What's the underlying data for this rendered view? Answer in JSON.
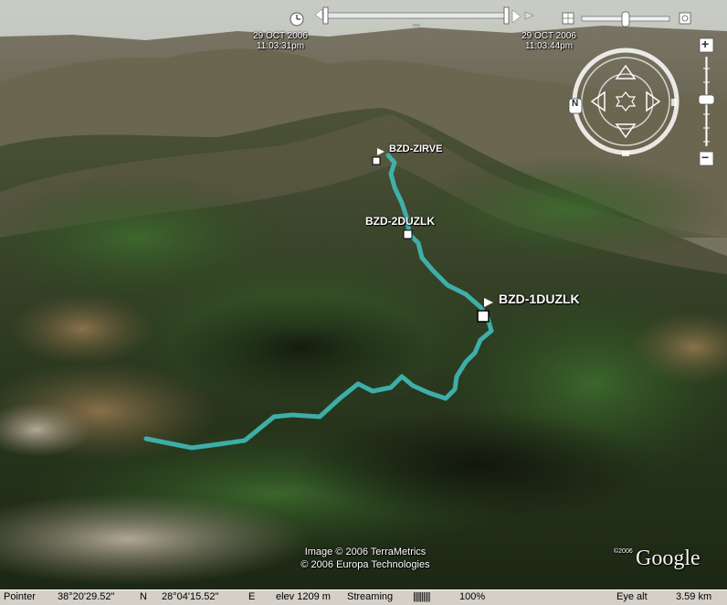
{
  "time_slider": {
    "start_date": "29 OCT 2006",
    "start_time": "11:03:31pm",
    "end_date": "29 OCT 2006",
    "end_time": "11:03:44pm"
  },
  "placemarks": [
    {
      "label": "BZD-ZIRVE"
    },
    {
      "label": "BZD-2DUZLK"
    },
    {
      "label": "BZD-1DUZLK"
    }
  ],
  "nav": {
    "north_label": "N",
    "zoom_in": "+",
    "zoom_out": "−"
  },
  "attribution": {
    "line1": "Image © 2006 TerraMetrics",
    "line2": "© 2006 Europa Technologies",
    "logo_year": "©2006",
    "logo": "Google"
  },
  "status": {
    "pointer_label": "Pointer",
    "latitude": "38°20'29.52\"",
    "lat_hemi": "N",
    "longitude": "28°04'15.52\"",
    "lon_hemi": "E",
    "elevation": "elev 1209 m",
    "streaming_label": "Streaming",
    "streaming_bar": "||||||||||",
    "streaming_pct": "100%",
    "eye_label": "Eye alt",
    "eye_alt": "3.59 km"
  },
  "colors": {
    "track": "#3fb8b4",
    "status_bar": "#d4d0c8"
  }
}
